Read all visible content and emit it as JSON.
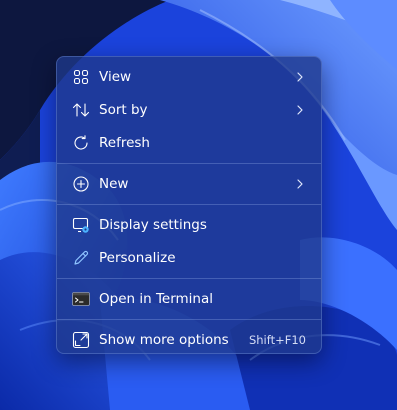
{
  "context_menu": {
    "items": {
      "view": {
        "label": "View",
        "icon": "grid-icon",
        "submenu": true
      },
      "sort_by": {
        "label": "Sort by",
        "icon": "sort-arrows-icon",
        "submenu": true
      },
      "refresh": {
        "label": "Refresh",
        "icon": "refresh-icon"
      },
      "new": {
        "label": "New",
        "icon": "plus-circle-icon",
        "submenu": true
      },
      "display_settings": {
        "label": "Display settings",
        "icon": "display-settings-icon"
      },
      "personalize": {
        "label": "Personalize",
        "icon": "pen-icon"
      },
      "open_terminal": {
        "label": "Open in Terminal",
        "icon": "terminal-icon"
      },
      "show_more_options": {
        "label": "Show more options",
        "icon": "expand-icon",
        "shortcut": "Shift+F10"
      }
    }
  },
  "colors": {
    "menu_background": "#1f388a",
    "text": "#ffffff",
    "wallpaper_blue": "#1d4ff0",
    "wallpaper_dark": "#0a143a"
  }
}
